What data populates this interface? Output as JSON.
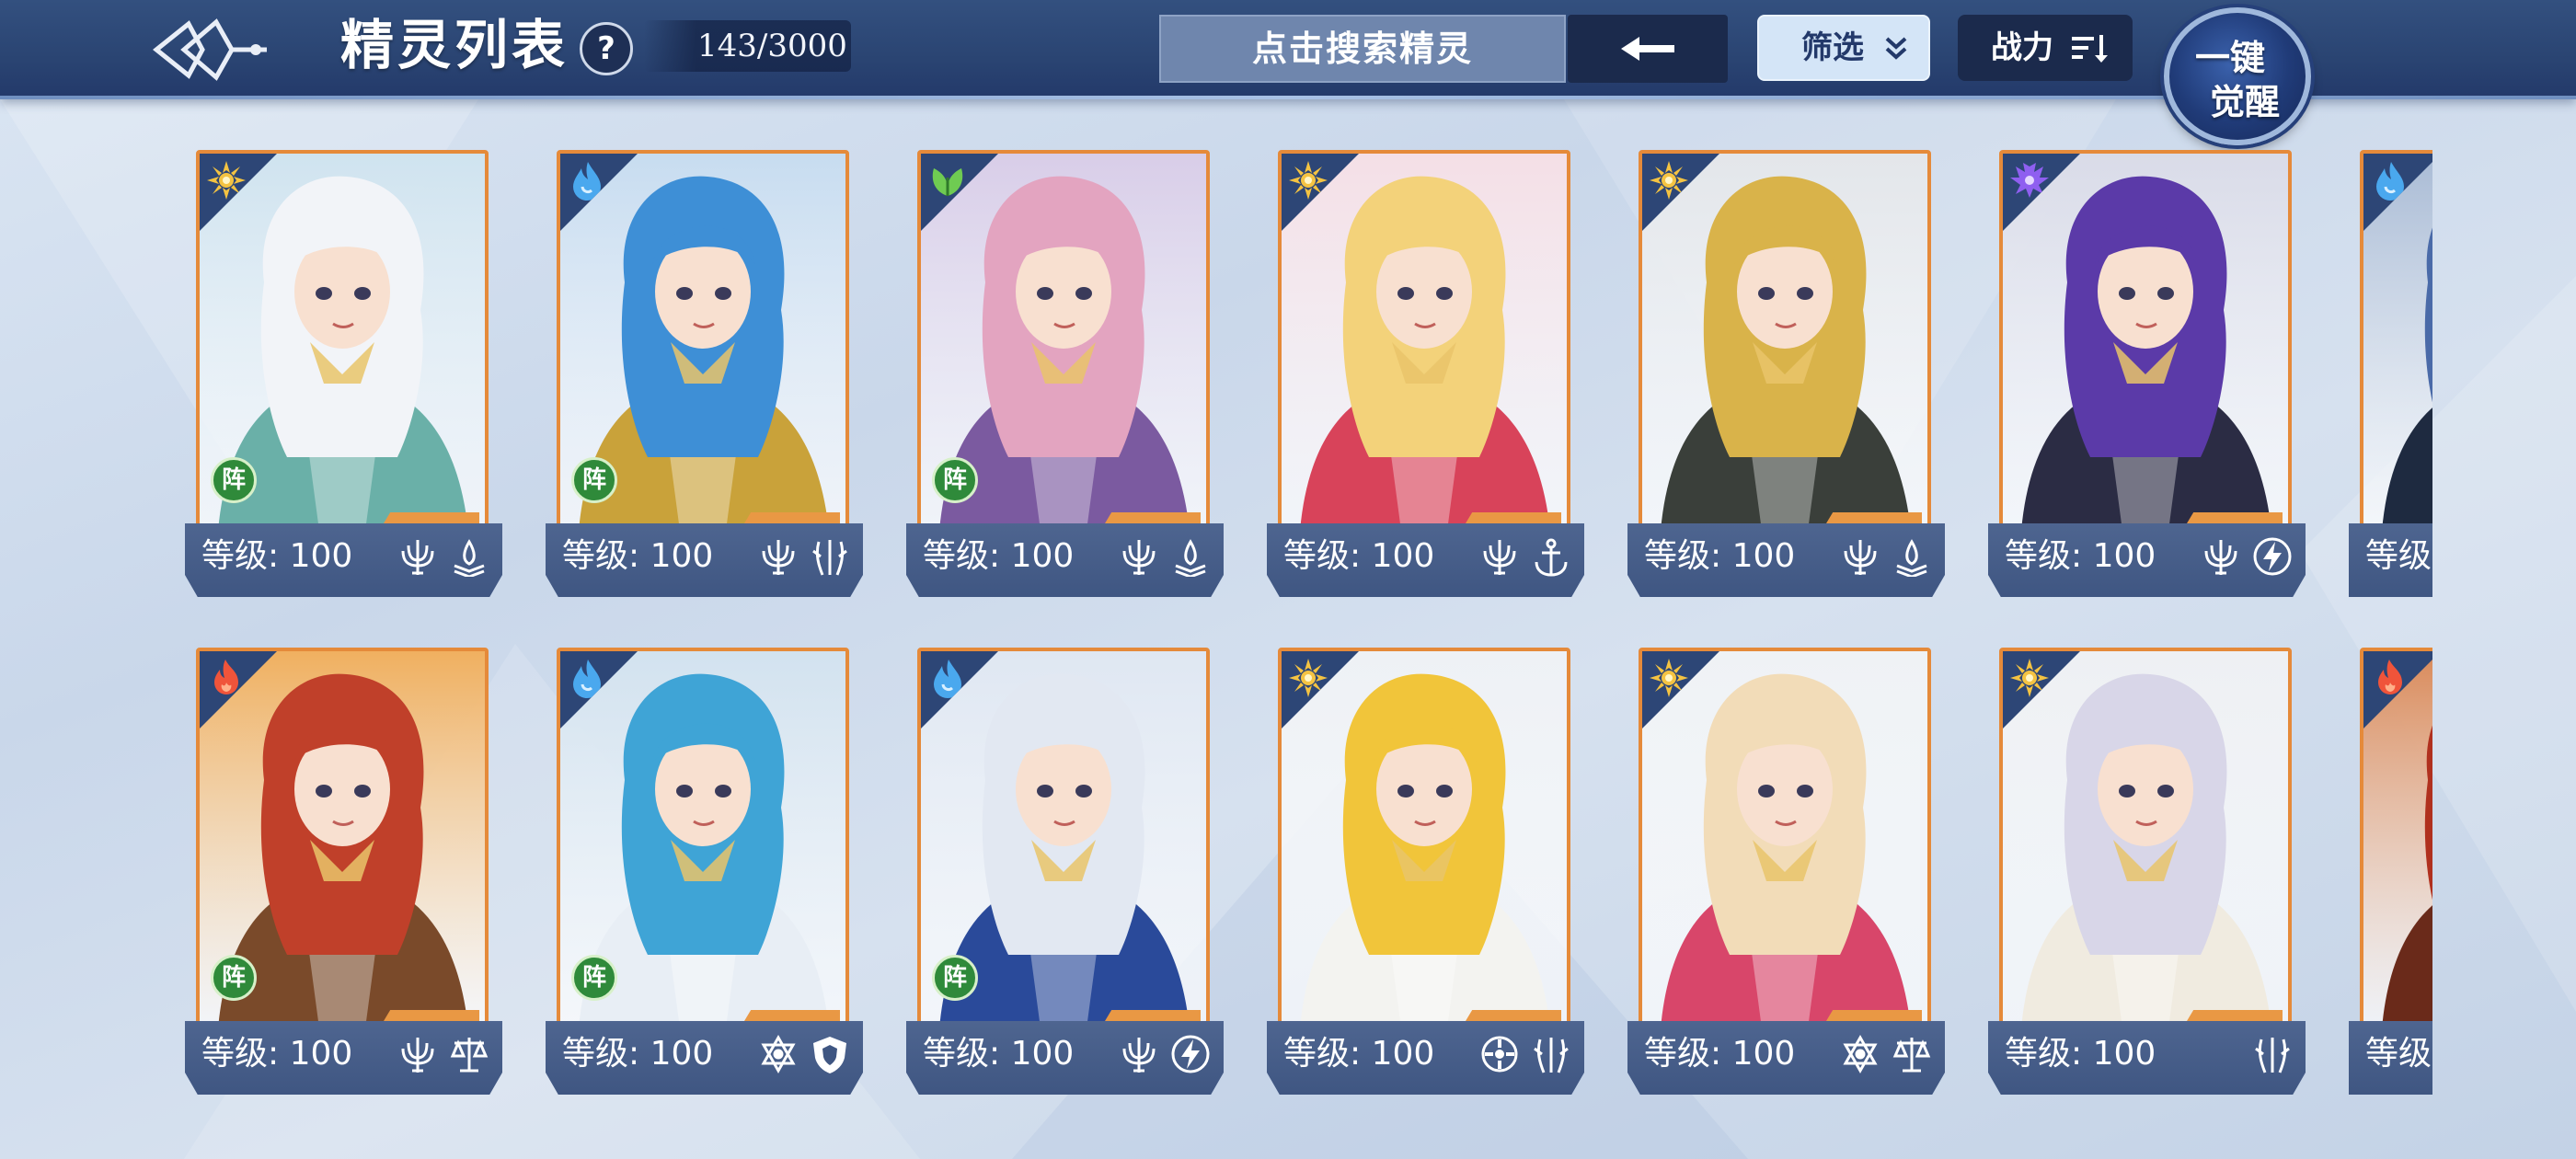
{
  "header": {
    "title": "精灵列表",
    "help_label": "?",
    "count": "143/3000",
    "search_placeholder": "点击搜索精灵",
    "filter_label": "筛选",
    "sort_label": "战力",
    "awaken_line1": "一键",
    "awaken_line2": "觉醒"
  },
  "colors": {
    "accent": "#e58a3a",
    "topbar": "#2a4472",
    "lineup_badge": "#2f8a3a"
  },
  "cards": [
    {
      "element": "light",
      "lineup": true,
      "level": "等级: 100",
      "skills": [
        "trident-icon",
        "flame-book-icon"
      ],
      "hair": "#f2f4f8",
      "outfit": "#6ab0a8",
      "bg": "#cfe3ef"
    },
    {
      "element": "water",
      "lineup": true,
      "level": "等级: 100",
      "skills": [
        "trident-icon",
        "claw-icon"
      ],
      "hair": "#3e8fd6",
      "outfit": "#c9a23a",
      "bg": "#c7dcf0"
    },
    {
      "element": "grass",
      "lineup": true,
      "level": "等级: 100",
      "skills": [
        "trident-icon",
        "flame-book-icon"
      ],
      "hair": "#e3a4c0",
      "outfit": "#7b5aa0",
      "bg": "#d8cde8"
    },
    {
      "element": "light",
      "lineup": false,
      "level": "等级: 100",
      "skills": [
        "trident-icon",
        "anchor-icon"
      ],
      "hair": "#f3d27a",
      "outfit": "#d8435a",
      "bg": "#f4dfe6"
    },
    {
      "element": "light",
      "lineup": false,
      "level": "等级: 100",
      "skills": [
        "trident-icon",
        "flame-book-icon"
      ],
      "hair": "#d9b34a",
      "outfit": "#3a3f3a",
      "bg": "#e3e6ea"
    },
    {
      "element": "dark",
      "lineup": false,
      "level": "等级: 100",
      "skills": [
        "trident-icon",
        "lightning-icon"
      ],
      "hair": "#5b3aa8",
      "outfit": "#2b2c44",
      "bg": "#d9dbe8"
    },
    {
      "element": "water",
      "lineup": false,
      "level": "等级",
      "skills": [],
      "hair": "#4a6aa8",
      "outfit": "#1e2a40",
      "bg": "#a9bbd5"
    },
    {
      "element": "fire",
      "lineup": true,
      "level": "等级: 100",
      "skills": [
        "trident-icon",
        "scales-icon"
      ],
      "hair": "#c0402a",
      "outfit": "#7a4a2a",
      "bg": "#f0b060"
    },
    {
      "element": "water",
      "lineup": true,
      "level": "等级: 100",
      "skills": [
        "hexagram-icon",
        "shield-icon"
      ],
      "hair": "#3fa4d6",
      "outfit": "#e8eef5",
      "bg": "#d2e2ef"
    },
    {
      "element": "water",
      "lineup": true,
      "level": "等级: 100",
      "skills": [
        "trident-icon",
        "lightning-icon"
      ],
      "hair": "#e2e8f2",
      "outfit": "#2a4a9a",
      "bg": "#dfe7f2"
    },
    {
      "element": "light",
      "lineup": false,
      "level": "等级: 100",
      "skills": [
        "gear-icon",
        "claw-icon"
      ],
      "hair": "#f1c53a",
      "outfit": "#f3f3f0",
      "bg": "#eef1f5"
    },
    {
      "element": "light",
      "lineup": false,
      "level": "等级: 100",
      "skills": [
        "hexagram-icon",
        "scales-icon"
      ],
      "hair": "#f2dcb8",
      "outfit": "#d8466a",
      "bg": "#eff2f5"
    },
    {
      "element": "light",
      "lineup": false,
      "level": "等级: 100",
      "skills": [
        "claw-icon"
      ],
      "hair": "#d8d6e8",
      "outfit": "#f0ebe0",
      "bg": "#eef0f3"
    },
    {
      "element": "fire",
      "lineup": false,
      "level": "等级",
      "skills": [],
      "hair": "#b0301e",
      "outfit": "#6a2a1a",
      "bg": "#d98a5a"
    }
  ],
  "lineup_label": "阵"
}
